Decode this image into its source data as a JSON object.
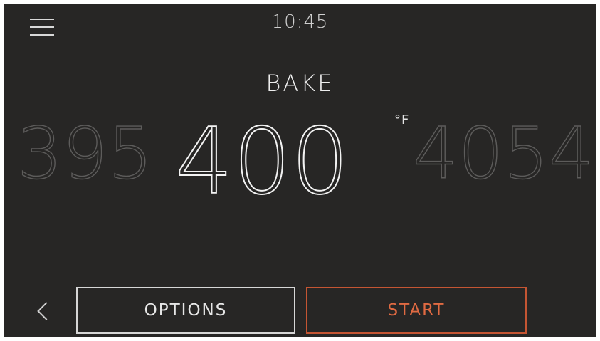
{
  "status_bar": {
    "time": "10:45",
    "menu_icon": "hamburger-menu-icon"
  },
  "cook_mode": {
    "title": "BAKE"
  },
  "temperature": {
    "previous": "395",
    "current": "400",
    "next": "4054",
    "unit": "°F"
  },
  "actions": {
    "back_icon": "chevron-left-icon",
    "options_label": "OPTIONS",
    "start_label": "START"
  },
  "colors": {
    "background": "#272625",
    "accent": "#e06a42"
  }
}
